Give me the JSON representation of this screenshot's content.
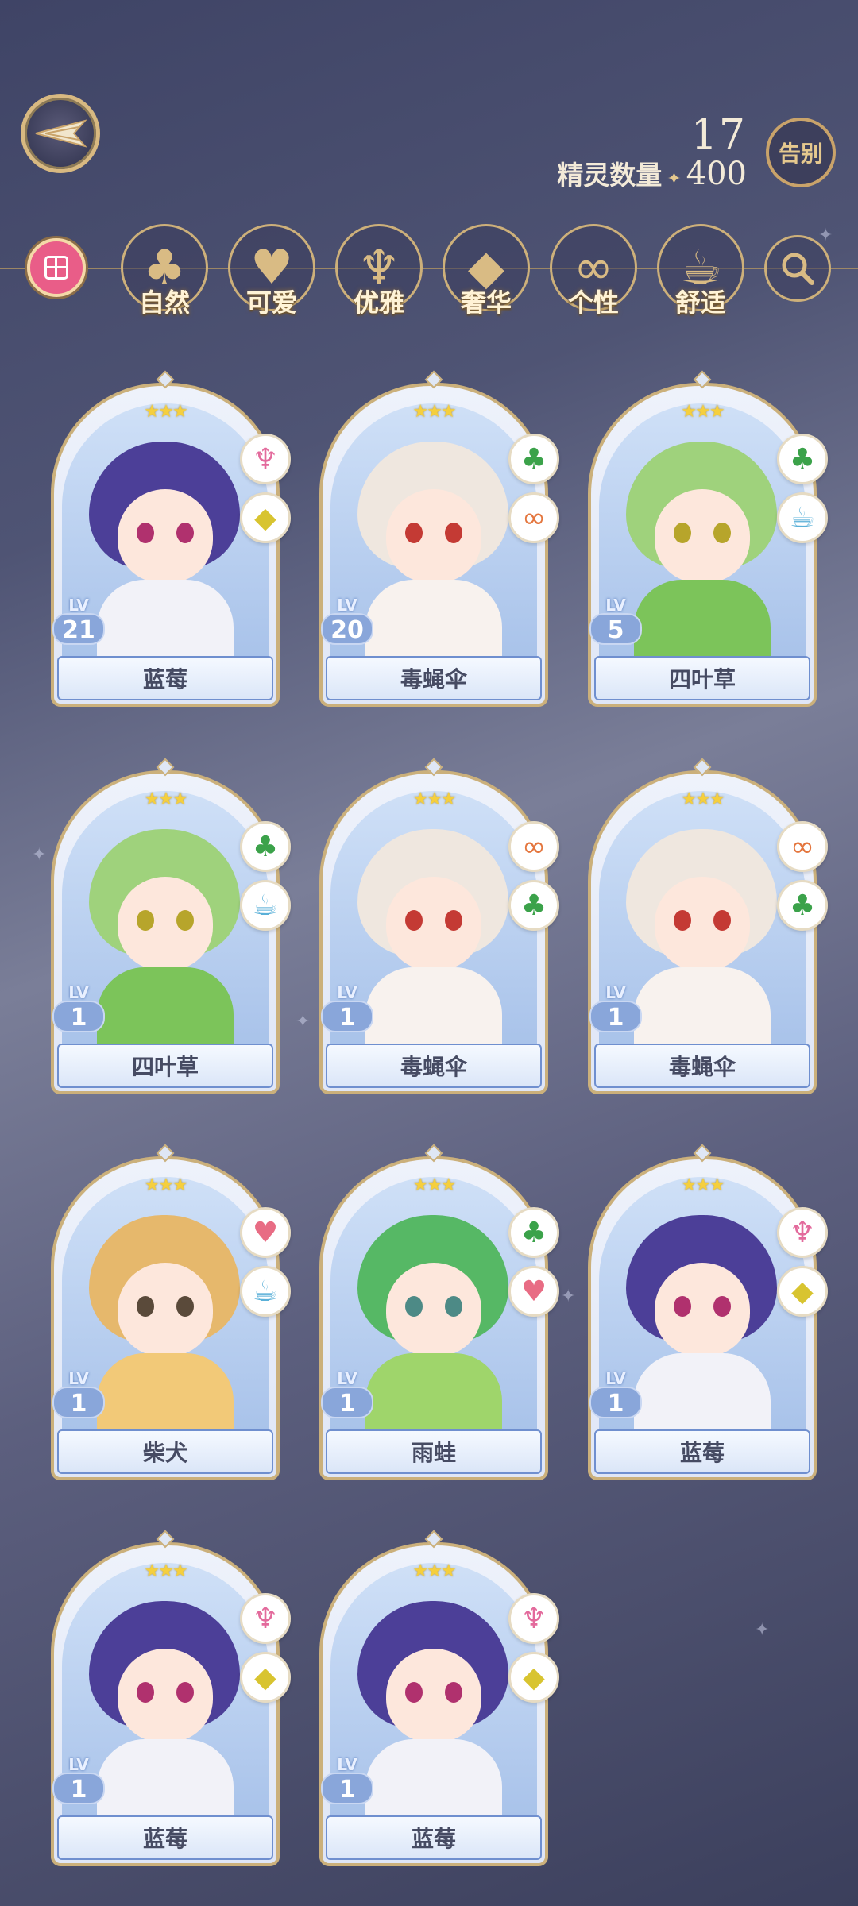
{
  "header": {
    "spirit_count": "17",
    "spirit_count_label": "精灵数量",
    "spirit_total": "400",
    "farewell_label": "告别"
  },
  "filters": [
    {
      "label": "自然",
      "icon": "clover-icon",
      "glyph": "♣"
    },
    {
      "label": "可爱",
      "icon": "heart-icon",
      "glyph": "♥"
    },
    {
      "label": "优雅",
      "icon": "swan-icon",
      "glyph": "♆"
    },
    {
      "label": "奢华",
      "icon": "diamond-icon",
      "glyph": "◆"
    },
    {
      "label": "个性",
      "icon": "glasses-icon",
      "glyph": "∞"
    },
    {
      "label": "舒适",
      "icon": "teacup-icon",
      "glyph": "☕"
    }
  ],
  "cards": [
    {
      "name": "蓝莓",
      "level": "21",
      "traits": [
        "swan-icon",
        "diamond-icon"
      ]
    },
    {
      "name": "毒蝇伞",
      "level": "20",
      "traits": [
        "clover-icon",
        "glasses-icon"
      ]
    },
    {
      "name": "四叶草",
      "level": "5",
      "traits": [
        "clover-icon",
        "teacup-icon"
      ]
    },
    {
      "name": "四叶草",
      "level": "1",
      "traits": [
        "clover-icon",
        "teacup-icon"
      ]
    },
    {
      "name": "毒蝇伞",
      "level": "1",
      "traits": [
        "glasses-icon",
        "clover-icon"
      ]
    },
    {
      "name": "毒蝇伞",
      "level": "1",
      "traits": [
        "glasses-icon",
        "clover-icon"
      ]
    },
    {
      "name": "柴犬",
      "level": "1",
      "traits": [
        "heart-icon",
        "teacup-icon"
      ]
    },
    {
      "name": "雨蛙",
      "level": "1",
      "traits": [
        "clover-icon",
        "heart-icon"
      ]
    },
    {
      "name": "蓝莓",
      "level": "1",
      "traits": [
        "swan-icon",
        "diamond-icon"
      ]
    },
    {
      "name": "蓝莓",
      "level": "1",
      "traits": [
        "swan-icon",
        "diamond-icon"
      ]
    },
    {
      "name": "蓝莓",
      "level": "1",
      "traits": [
        "swan-icon",
        "diamond-icon"
      ]
    }
  ],
  "level_prefix": "LV",
  "star_glyphs": "★★★",
  "colors": {
    "accent_gold": "#cbb07b",
    "all_filter": "#e95d88",
    "name_bar_border": "#6f8fcf"
  }
}
